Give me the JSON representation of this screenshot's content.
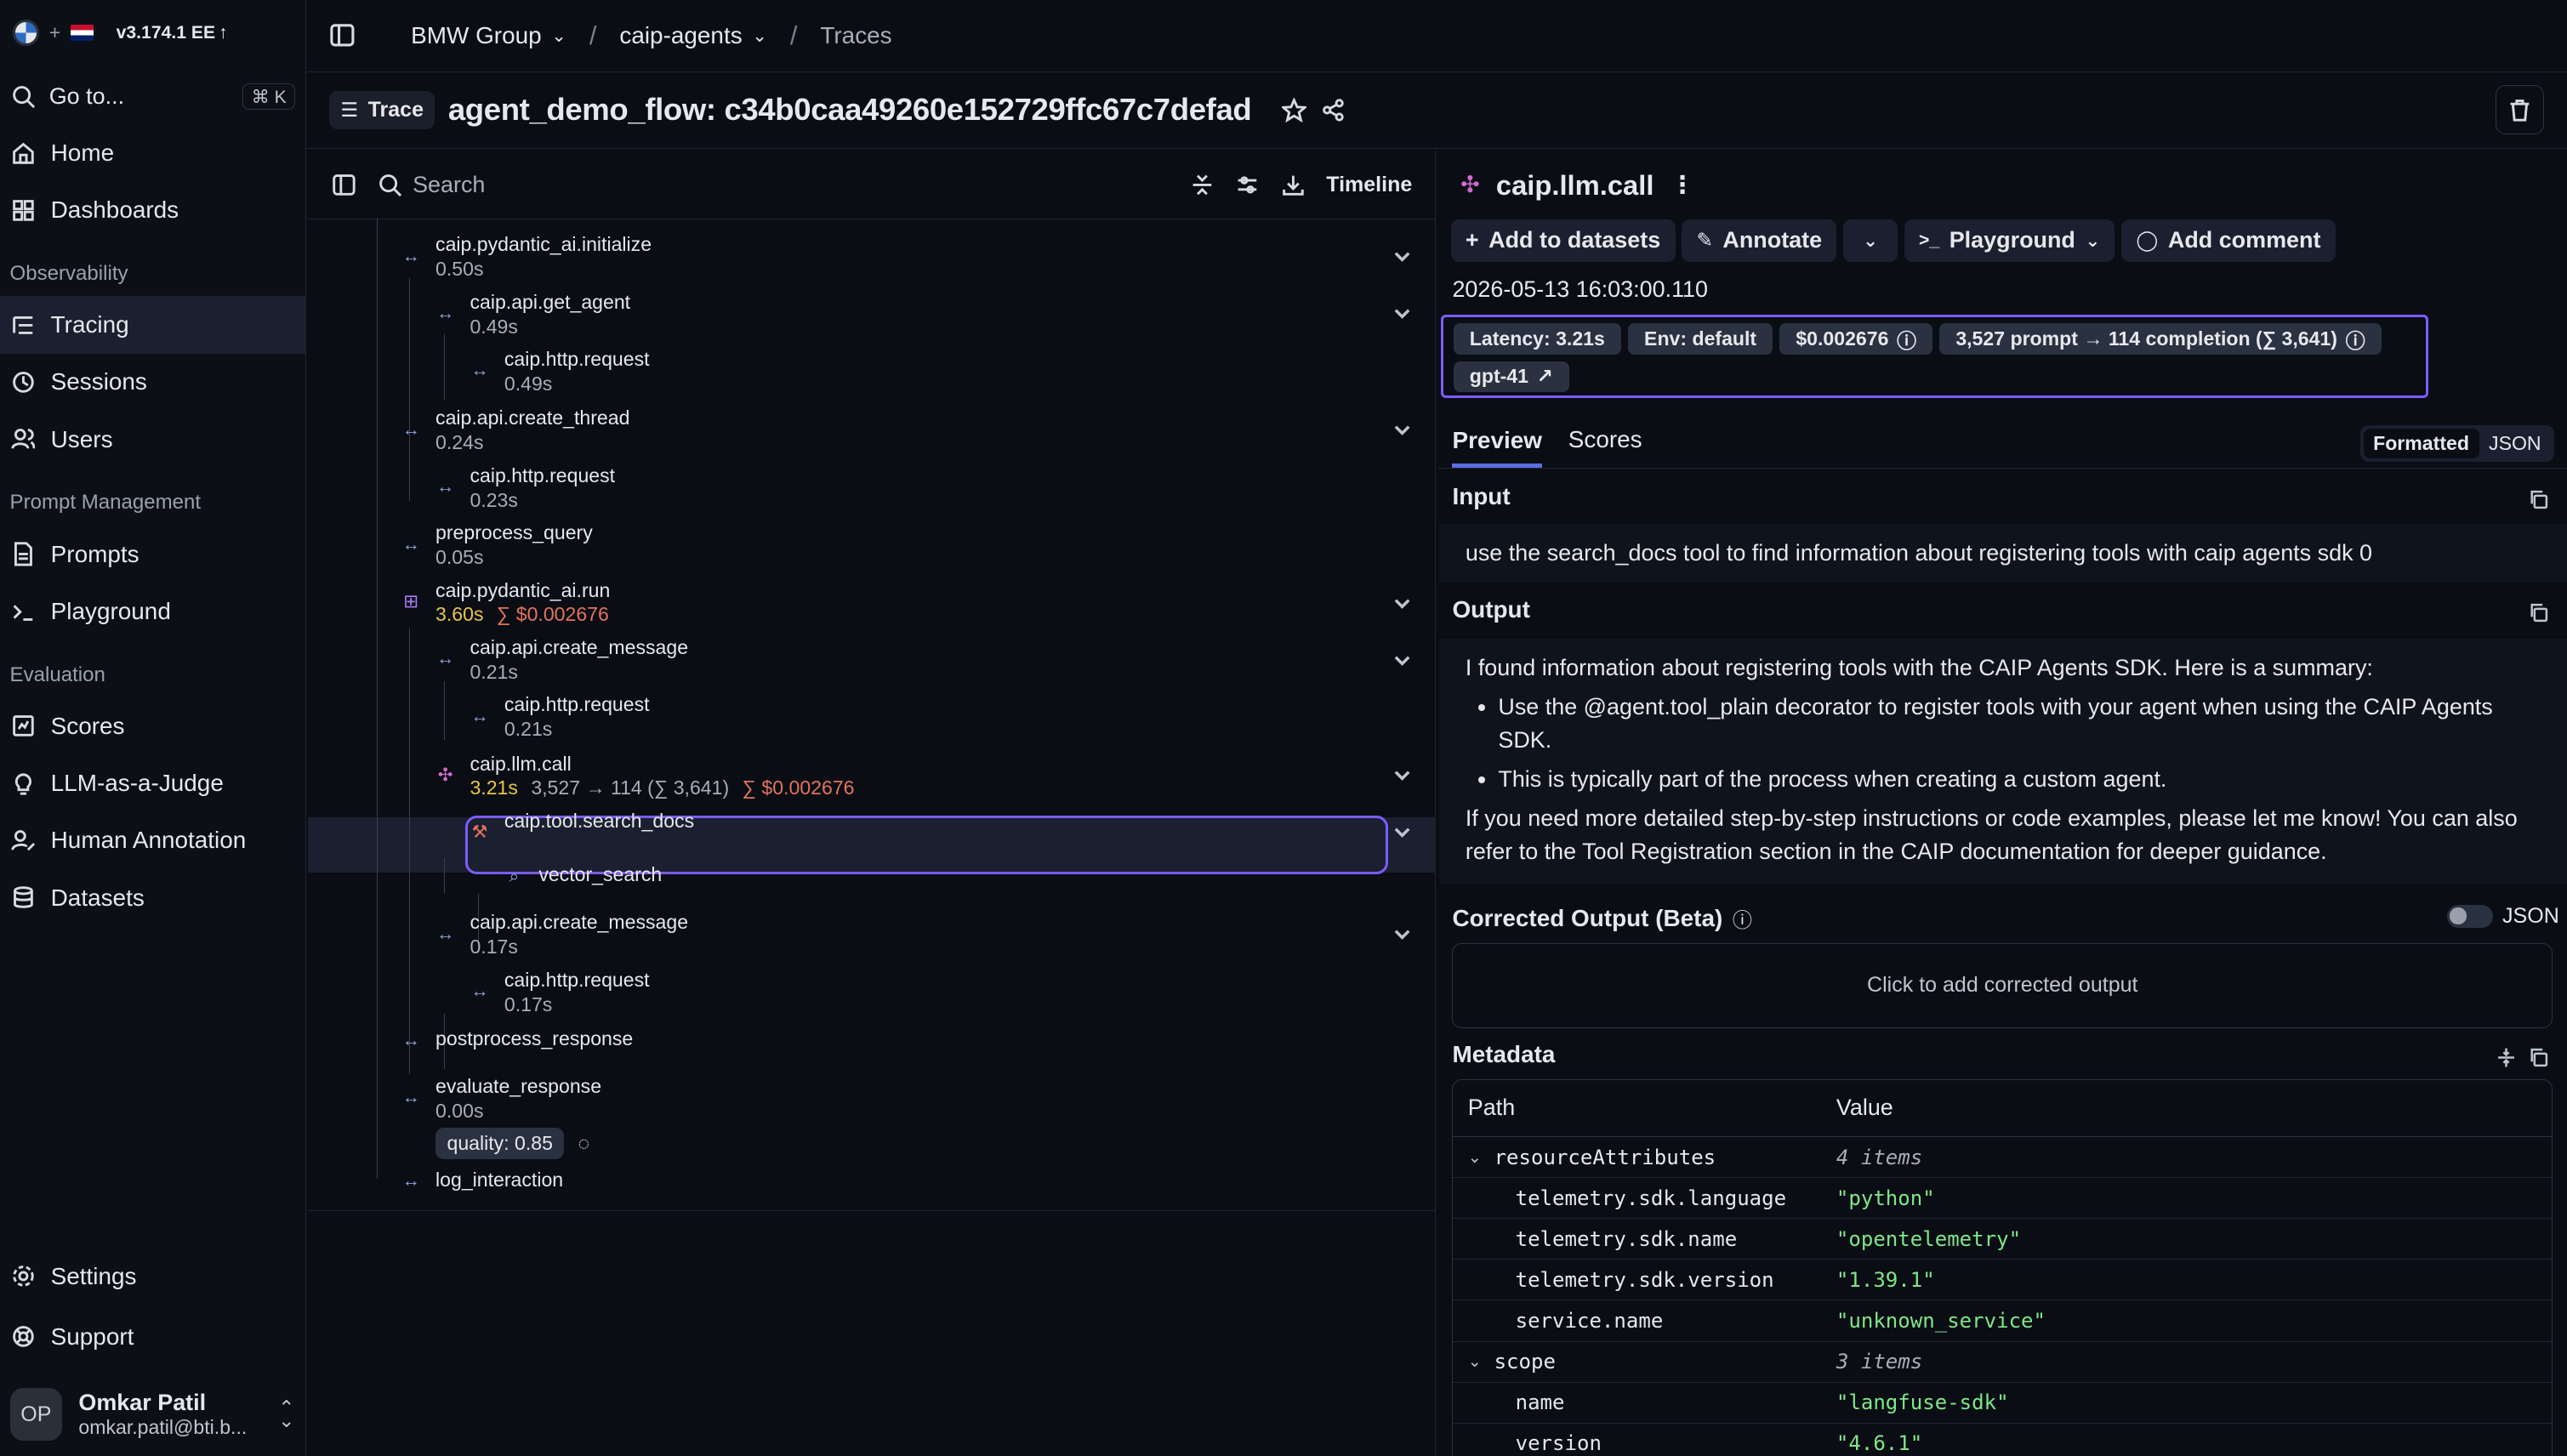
{
  "app": {
    "version": "v3.174.1 EE",
    "plus": "+"
  },
  "sidebar": {
    "goto_label": "Go to...",
    "goto_shortcut": "⌘ K",
    "home": "Home",
    "dashboards": "Dashboards",
    "section_observability": "Observability",
    "tracing": "Tracing",
    "sessions": "Sessions",
    "users": "Users",
    "section_prompt_management": "Prompt Management",
    "prompts": "Prompts",
    "playground": "Playground",
    "section_evaluation": "Evaluation",
    "scores": "Scores",
    "llm_as_judge": "LLM-as-a-Judge",
    "human_annotation": "Human Annotation",
    "datasets": "Datasets",
    "settings": "Settings",
    "support": "Support",
    "user": {
      "initials": "OP",
      "name": "Omkar Patil",
      "email": "omkar.patil@bti.b..."
    }
  },
  "breadcrumb": {
    "org": "BMW Group",
    "project": "caip-agents",
    "page": "Traces"
  },
  "trace": {
    "badge": "Trace",
    "title": "agent_demo_flow: c34b0caa49260e152729ffc67c7defad"
  },
  "tree": {
    "search_placeholder": "Search",
    "timeline_label": "Timeline",
    "nodes": [
      {
        "name": "caip.pydantic_ai.initialize",
        "duration": "0.50s"
      },
      {
        "name": "caip.api.get_agent",
        "duration": "0.49s"
      },
      {
        "name": "caip.http.request",
        "duration": "0.49s"
      },
      {
        "name": "caip.api.create_thread",
        "duration": "0.24s"
      },
      {
        "name": "caip.http.request",
        "duration": "0.23s"
      },
      {
        "name": "preprocess_query",
        "duration": "0.05s"
      },
      {
        "name": "caip.pydantic_ai.run",
        "duration": "3.60s",
        "cost": "∑ $0.002676"
      },
      {
        "name": "caip.api.create_message",
        "duration": "0.21s"
      },
      {
        "name": "caip.http.request",
        "duration": "0.21s"
      },
      {
        "name": "caip.llm.call",
        "duration": "3.21s",
        "tokens": "3,527 → 114 (∑ 3,641)",
        "cost": "∑ $0.002676"
      },
      {
        "name": "caip.tool.search_docs"
      },
      {
        "name": "vector_search"
      },
      {
        "name": "caip.api.create_message",
        "duration": "0.17s"
      },
      {
        "name": "caip.http.request",
        "duration": "0.17s"
      },
      {
        "name": "postprocess_response"
      },
      {
        "name": "evaluate_response",
        "duration": "0.00s",
        "score": "quality: 0.85"
      },
      {
        "name": "log_interaction"
      }
    ]
  },
  "detail": {
    "title": "caip.llm.call",
    "buttons": {
      "add_to_datasets": "Add to datasets",
      "annotate": "Annotate",
      "playground": "Playground",
      "add_comment": "Add comment"
    },
    "timestamp": "2026-05-13 16:03:00.110",
    "chips": {
      "latency": "Latency: 3.21s",
      "env": "Env: default",
      "cost": "$0.002676",
      "tokens": "3,527 prompt → 114 completion (∑ 3,641)",
      "model": "gpt-41"
    },
    "tabs": {
      "preview": "Preview",
      "scores": "Scores"
    },
    "format_toggle": {
      "formatted": "Formatted",
      "json": "JSON"
    },
    "input_title": "Input",
    "input_text": "use the search_docs tool to find information about registering tools with caip agents sdk  0",
    "output_title": "Output",
    "output_intro": "I found information about registering tools with the CAIP Agents SDK. Here is a summary:",
    "output_bullets": [
      "Use the @agent.tool_plain decorator to register tools with your agent when using the CAIP Agents SDK.",
      "This is typically part of the process when creating a custom agent."
    ],
    "output_outro": "If you need more detailed step-by-step instructions or code examples, please let me know! You can also refer to the Tool Registration section in the CAIP documentation for deeper guidance.",
    "corrected_title": "Corrected Output (Beta)",
    "corrected_json_label": "JSON",
    "corrected_placeholder": "Click to add corrected output",
    "metadata_title": "Metadata",
    "metadata_columns": {
      "path": "Path",
      "value": "Value"
    },
    "metadata_rows": [
      {
        "path": "resourceAttributes",
        "value": "4 items",
        "group": true
      },
      {
        "path": "telemetry.sdk.language",
        "value": "\"python\""
      },
      {
        "path": "telemetry.sdk.name",
        "value": "\"opentelemetry\""
      },
      {
        "path": "telemetry.sdk.version",
        "value": "\"1.39.1\""
      },
      {
        "path": "service.name",
        "value": "\"unknown_service\""
      },
      {
        "path": "scope",
        "value": "3 items",
        "group": true
      },
      {
        "path": "name",
        "value": "\"langfuse-sdk\""
      },
      {
        "path": "version",
        "value": "\"4.6.1\""
      }
    ]
  },
  "colors": {
    "accent": "#7c5cff",
    "background": "#0a0d14",
    "duration_highlight": "#e8c547",
    "cost": "#e4735b",
    "string_value": "#7ee787"
  }
}
